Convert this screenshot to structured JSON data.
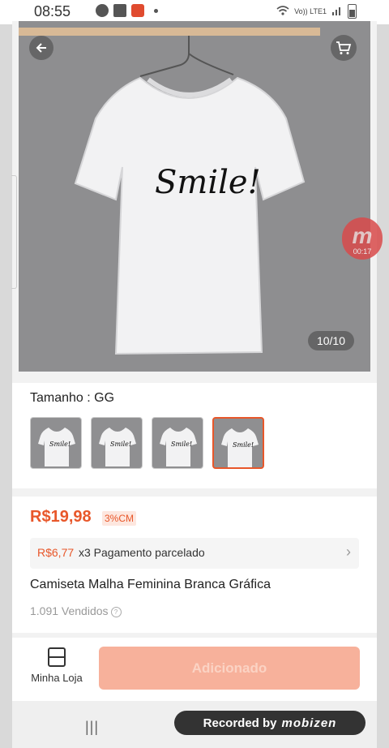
{
  "status": {
    "time": "08:55",
    "network": "Vo)) LTE1"
  },
  "hero": {
    "counter": "10/10",
    "shirt_text": "Smile!"
  },
  "recorder_bubble": {
    "logo": "m",
    "elapsed": "00:17"
  },
  "variant": {
    "size_label": "Tamanho : GG",
    "thumb_count": 4,
    "selected_index": 3
  },
  "product": {
    "price": "R$19,98",
    "cm_badge": "3%CM",
    "installment_price": "R$6,77",
    "installment_text": "x3 Pagamento parcelado",
    "title": "Camiseta Malha Feminina Branca Gráfica",
    "sold": "1.091 Vendidos",
    "sold_help": "?"
  },
  "bottom": {
    "store_label": "Minha Loja",
    "add_label": "Adicionado"
  },
  "nav": {
    "recent_glyph": "|||",
    "recorded_label": "Recorded by",
    "recorded_brand": "mobizen"
  },
  "colors": {
    "accent": "#e8572a",
    "button_disabled": "#f7b19b"
  }
}
